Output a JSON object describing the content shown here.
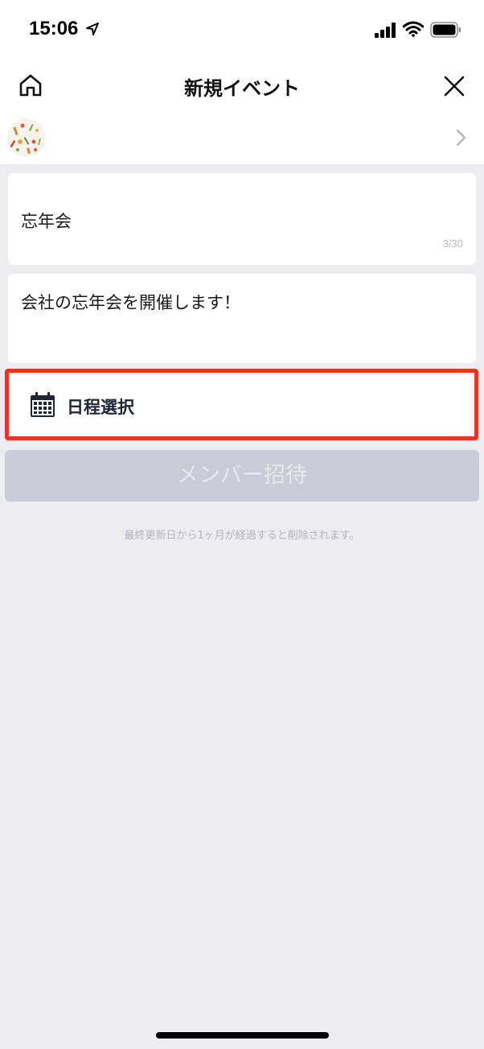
{
  "status_bar": {
    "time": "15:06"
  },
  "header": {
    "title": "新規イベント",
    "home_icon": "home-icon",
    "close_icon": "close-icon"
  },
  "theme": {
    "chevron_icon": "chevron-right-icon"
  },
  "form": {
    "title_value": "忘年会",
    "title_counter": "3/30",
    "description_value": "会社の忘年会を開催します！",
    "schedule_label": "日程選択",
    "schedule_icon": "calendar-icon",
    "invite_label": "メンバー招待",
    "notice": "最終更新日から1ヶ月が経過すると削除されます。"
  },
  "colors": {
    "highlight_border": "#f0321e",
    "disabled_button": "#c9ccd6",
    "background": "#ececf1"
  }
}
